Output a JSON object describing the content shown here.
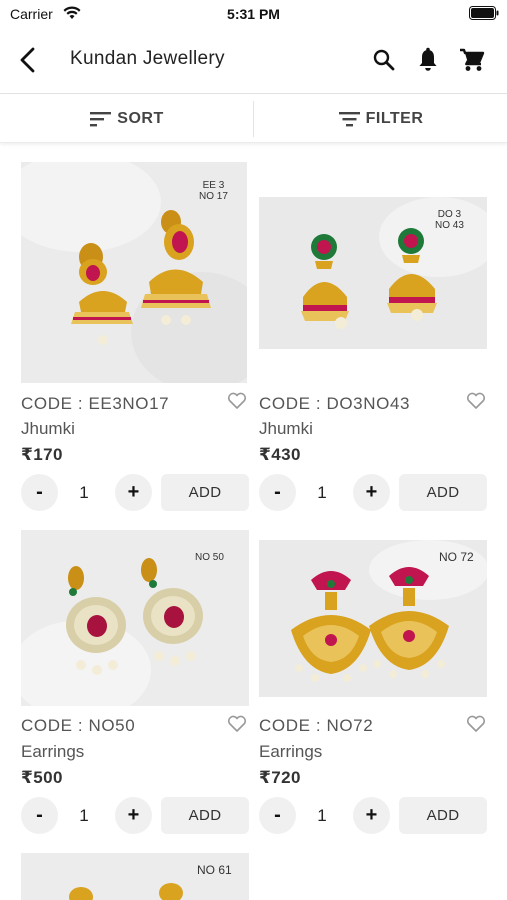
{
  "status_bar": {
    "carrier": "Carrier",
    "time": "5:31 PM"
  },
  "header": {
    "title": "Kundan Jewellery"
  },
  "toolbar": {
    "sort_label": "SORT",
    "filter_label": "FILTER"
  },
  "products": [
    {
      "tag_line1": "EE 3",
      "tag_line2": "NO 17",
      "code": "CODE : EE3NO17",
      "type": "Jhumki",
      "price": "₹170",
      "qty": "1",
      "add_label": "ADD",
      "minus": "-",
      "plus": "+"
    },
    {
      "tag_line1": "DO 3",
      "tag_line2": "NO 43",
      "code": "CODE : DO3NO43",
      "type": "Jhumki",
      "price": "₹430",
      "qty": "1",
      "add_label": "ADD",
      "minus": "-",
      "plus": "+"
    },
    {
      "tag_line1": "NO 50",
      "tag_line2": "",
      "code": "CODE : NO50",
      "type": "Earrings",
      "price": "₹500",
      "qty": "1",
      "add_label": "ADD",
      "minus": "-",
      "plus": "+"
    },
    {
      "tag_line1": "NO 72",
      "tag_line2": "",
      "code": "CODE : NO72",
      "type": "Earrings",
      "price": "₹720",
      "qty": "1",
      "add_label": "ADD",
      "minus": "-",
      "plus": "+"
    },
    {
      "tag_line1": "NO 61",
      "tag_line2": ""
    }
  ],
  "colors": {
    "gold": "#d9a21f",
    "ruby": "#c0154f",
    "emerald": "#1f7a3a",
    "pearl": "#f3ecd7",
    "bg_white": "#ececec"
  }
}
